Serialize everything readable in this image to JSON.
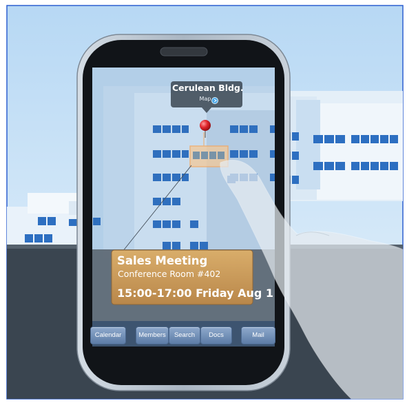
{
  "location_callout": {
    "title": "Cerulean Bldg.",
    "link_label": "Map",
    "link_icon": "arrow-circle-icon"
  },
  "event_card": {
    "title": "Sales Meeting",
    "room": "Conference Room #402",
    "time": "15:00-17:00 Friday Aug 1"
  },
  "tab_bar": {
    "items": [
      {
        "label": "Calendar"
      },
      {
        "label": "Members"
      },
      {
        "label": "Search"
      },
      {
        "label": "Docs"
      },
      {
        "label": "Mail"
      }
    ]
  },
  "colors": {
    "sky": "#cfe4f7",
    "ground": "#3a4550",
    "window": "#2d6fc1",
    "phone_frame": "#b9c4cf",
    "pin": "#e0262c",
    "card": "#c79a58",
    "tab": "#6f8fb8"
  }
}
